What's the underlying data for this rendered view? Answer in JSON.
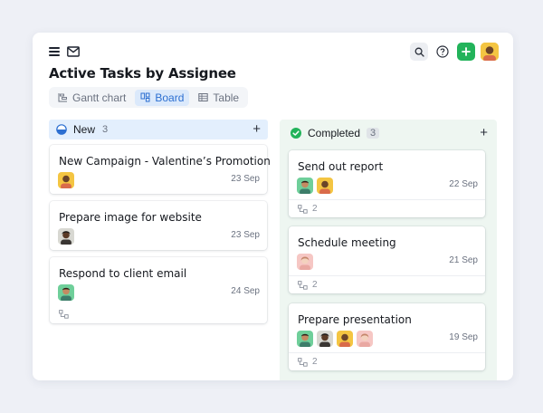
{
  "header": {
    "title": "Active Tasks by Assignee",
    "icons": [
      "menu-icon",
      "mail-icon",
      "search-icon",
      "help-icon",
      "plus-icon",
      "avatar"
    ],
    "accent": "#22b35a"
  },
  "view_tabs": [
    {
      "label": "Gantt chart",
      "icon": "gantt-icon",
      "active": false
    },
    {
      "label": "Board",
      "icon": "board-icon",
      "active": true
    },
    {
      "label": "Table",
      "icon": "table-icon",
      "active": false
    }
  ],
  "columns": {
    "new": {
      "name": "New",
      "count": "3",
      "status_color": "#2c6fd1",
      "cards": [
        {
          "title": "New Campaign - Valentine’s Promotion",
          "date": "23 Sep"
        },
        {
          "title": "Prepare image for website",
          "date": "23 Sep"
        },
        {
          "title": "Respond to client email",
          "date": "24 Sep"
        }
      ]
    },
    "completed": {
      "name": "Completed",
      "count": "3",
      "status_color": "#22b35a",
      "cards": [
        {
          "title": "Send out report",
          "date": "22 Sep",
          "subtasks": "2"
        },
        {
          "title": "Schedule meeting",
          "date": "21 Sep",
          "subtasks": "2"
        },
        {
          "title": "Prepare presentation",
          "date": "19 Sep",
          "subtasks": "2"
        }
      ]
    }
  }
}
